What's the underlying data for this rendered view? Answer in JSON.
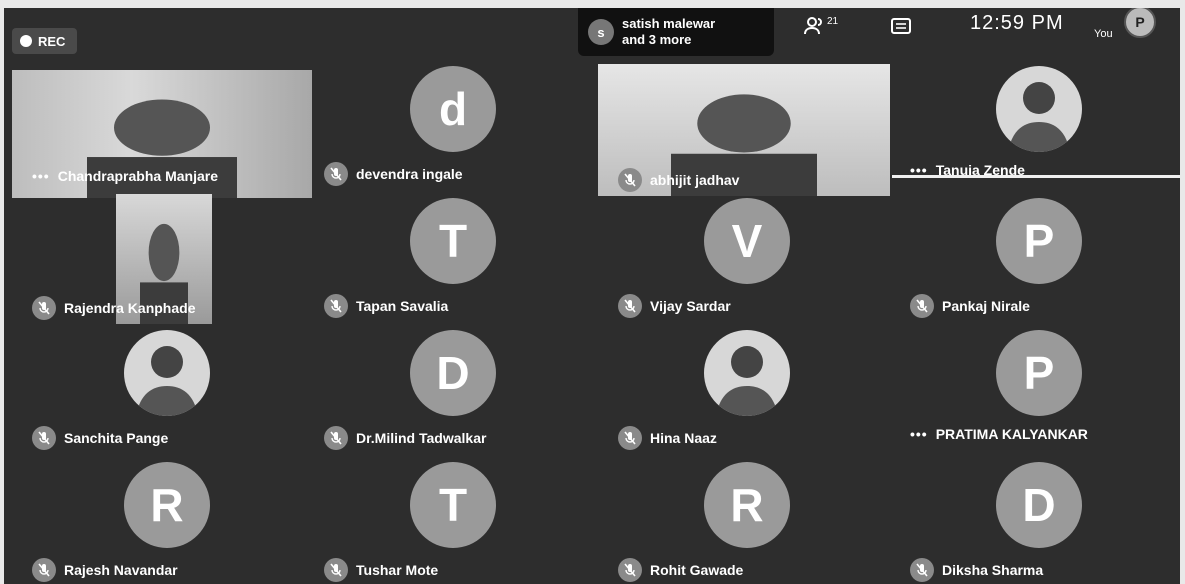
{
  "recording": {
    "label": "REC"
  },
  "speaking": {
    "initial": "s",
    "line1": "satish malewar",
    "line2": "and 3 more"
  },
  "toolbar": {
    "participants_count": "21",
    "time": "12:59 PM",
    "you_label": "You",
    "self_initial": "P"
  },
  "tiles": [
    {
      "name": "Chandraprabha Manjare",
      "display": "video",
      "menu": true
    },
    {
      "name": "devendra ingale",
      "display": "avatar",
      "initial": "d",
      "muted": true
    },
    {
      "name": "abhijit jadhav",
      "display": "video",
      "muted": true
    },
    {
      "name": "Tanuja Zende",
      "display": "photo",
      "menu": true
    },
    {
      "name": "Rajendra Kanphade",
      "display": "video",
      "muted": true
    },
    {
      "name": "Tapan Savalia",
      "display": "avatar",
      "initial": "T",
      "muted": true
    },
    {
      "name": "Vijay Sardar",
      "display": "avatar",
      "initial": "V",
      "muted": true
    },
    {
      "name": "Pankaj Nirale",
      "display": "avatar",
      "initial": "P",
      "muted": true
    },
    {
      "name": "Sanchita Pange",
      "display": "photo",
      "muted": true
    },
    {
      "name": "Dr.Milind Tadwalkar",
      "display": "avatar",
      "initial": "D",
      "muted": true
    },
    {
      "name": "Hina Naaz",
      "display": "photo",
      "muted": true
    },
    {
      "name": "PRATIMA KALYANKAR",
      "display": "avatar",
      "initial": "P",
      "menu": true
    },
    {
      "name": "Rajesh Navandar",
      "display": "avatar",
      "initial": "R",
      "muted": true
    },
    {
      "name": "Tushar Mote",
      "display": "avatar",
      "initial": "T",
      "muted": true
    },
    {
      "name": "Rohit Gawade",
      "display": "avatar",
      "initial": "R",
      "muted": true
    },
    {
      "name": "Diksha Sharma",
      "display": "avatar",
      "initial": "D",
      "muted": true
    }
  ]
}
